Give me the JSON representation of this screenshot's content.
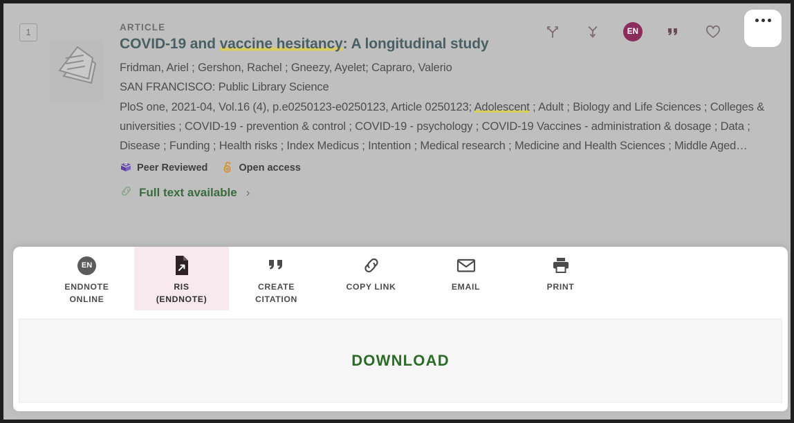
{
  "record": {
    "selector_number": "1",
    "kicker": "ARTICLE",
    "title_part1": "COVID-19 and ",
    "title_highlight": "vaccine hesitancy",
    "title_part2": ": A longitudinal study",
    "authors": "Fridman, Ariel ; Gershon, Rachel ; Gneezy, Ayelet; Capraro, Valerio",
    "publisher": "SAN FRANCISCO: Public Library Science",
    "citation_prefix": "PloS one, 2021-04, Vol.16 (4), p.e0250123-e0250123, Article 0250123; ",
    "citation_highlight": "Adolescent",
    "citation_suffix": " ; Adult ; Biology and Life Sciences ; Colleges & universities ; COVID-19 - prevention & control ; COVID-19 - psychology ; COVID-19 Vaccines - administration & dosage ; Data ; Disease ; Funding ; Health risks ; Index Medicus ; Intention ; Medical research ; Medicine and Health Sciences ; Middle Aged…",
    "peer_reviewed_label": "Peer Reviewed",
    "open_access_label": "Open access",
    "full_text_label": "Full text available",
    "full_text_chevron": "›",
    "thumbnail_icon": "document-pages-icon"
  },
  "actions": {
    "share_icon": "share-arrow-icon",
    "save_icon": "arrow-down-merge-icon",
    "endnote_chip_label": "EN",
    "cite_icon": "quote-icon",
    "favorite_icon": "heart-icon",
    "more_icon": "more-options-icon"
  },
  "panel": {
    "tabs": [
      {
        "label": "ENDNOTE\nONLINE",
        "icon": "endnote-online-icon",
        "selected": false
      },
      {
        "label": "RIS\n(ENDNOTE)",
        "icon": "ris-file-export-icon",
        "selected": true
      },
      {
        "label": "CREATE\nCITATION",
        "icon": "quote-icon",
        "selected": false
      },
      {
        "label": "COPY LINK",
        "icon": "link-icon",
        "selected": false
      },
      {
        "label": "EMAIL",
        "icon": "envelope-icon",
        "selected": false
      },
      {
        "label": "PRINT",
        "icon": "printer-icon",
        "selected": false
      }
    ],
    "download_label": "DOWNLOAD"
  },
  "colors": {
    "accent_maroon": "#8b2d5c",
    "selected_tab_bg": "#f8e9ef",
    "download_green": "#2c6b28",
    "title_teal": "#4a5f63",
    "highlight_yellow": "#d9cd62",
    "peer_reviewed_purple": "#6b4fb5",
    "open_access_orange": "#d88a2a"
  }
}
